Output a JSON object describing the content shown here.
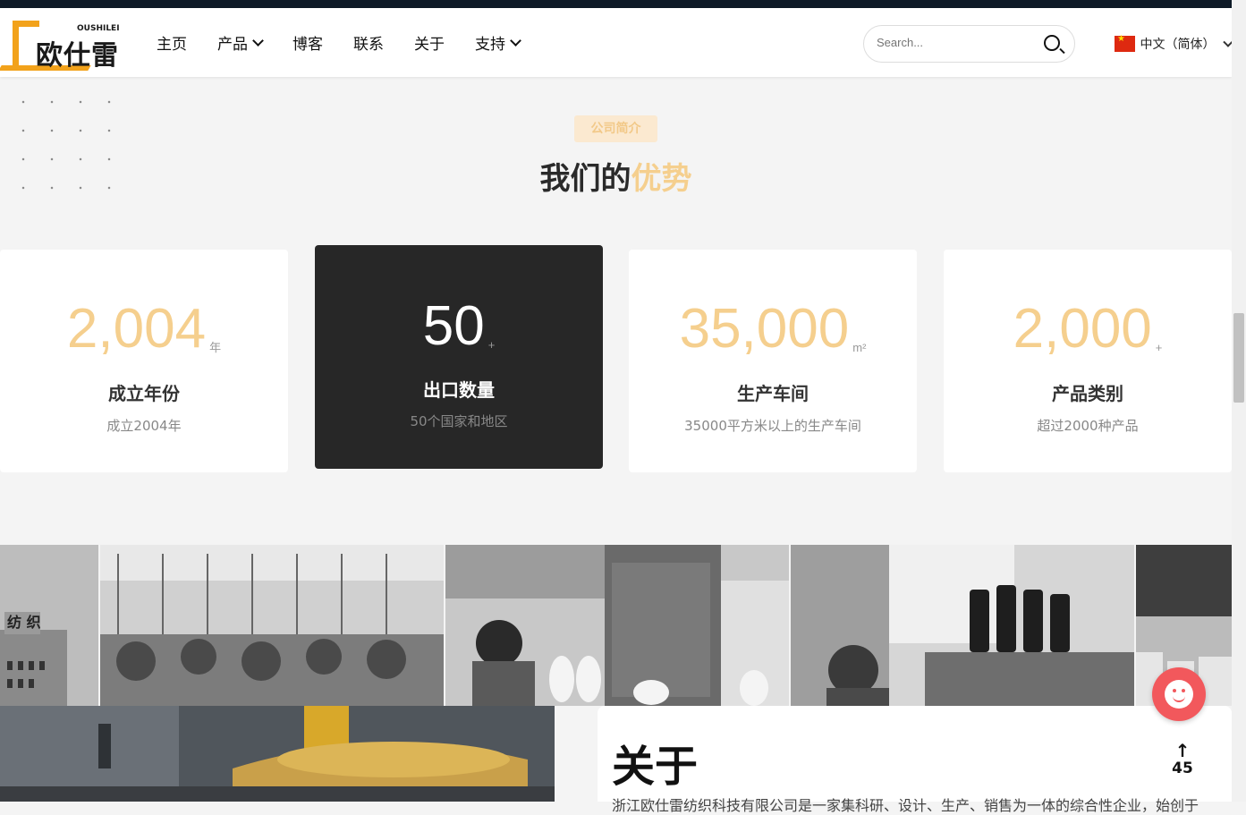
{
  "logo": {
    "brand": "欧仕雷",
    "sub": "OUSHILEI"
  },
  "nav": [
    {
      "label": "主页",
      "dropdown": false
    },
    {
      "label": "产品",
      "dropdown": true
    },
    {
      "label": "博客",
      "dropdown": false
    },
    {
      "label": "联系",
      "dropdown": false
    },
    {
      "label": "关于",
      "dropdown": false
    },
    {
      "label": "支持",
      "dropdown": true
    }
  ],
  "search": {
    "placeholder": "Search..."
  },
  "language": {
    "label": "中文（简体）",
    "flag": "cn-flag-icon"
  },
  "section": {
    "tag": "公司简介",
    "heading_plain": "我们的",
    "heading_accent": "优势"
  },
  "stats": [
    {
      "value": "2,004",
      "unit": "年",
      "title": "成立年份",
      "desc": "成立2004年"
    },
    {
      "value": "50",
      "unit": "+",
      "title": "出口数量",
      "desc": "50个国家和地区"
    },
    {
      "value": "35,000",
      "unit": "m²",
      "title": "生产车间",
      "desc": "35000平方米以上的生产车间"
    },
    {
      "value": "2,000",
      "unit": "+",
      "title": "产品类别",
      "desc": "超过2000种产品"
    }
  ],
  "about": {
    "title": "关于",
    "text": "浙江欧仕雷纺织科技有限公司是一家集科研、设计、生产、销售为一体的综合性企业，始创于"
  },
  "back_to_top": {
    "count": "45"
  },
  "colors": {
    "accent": "#f5cf8e",
    "dark_card": "#272727",
    "chat": "#f2585c"
  }
}
